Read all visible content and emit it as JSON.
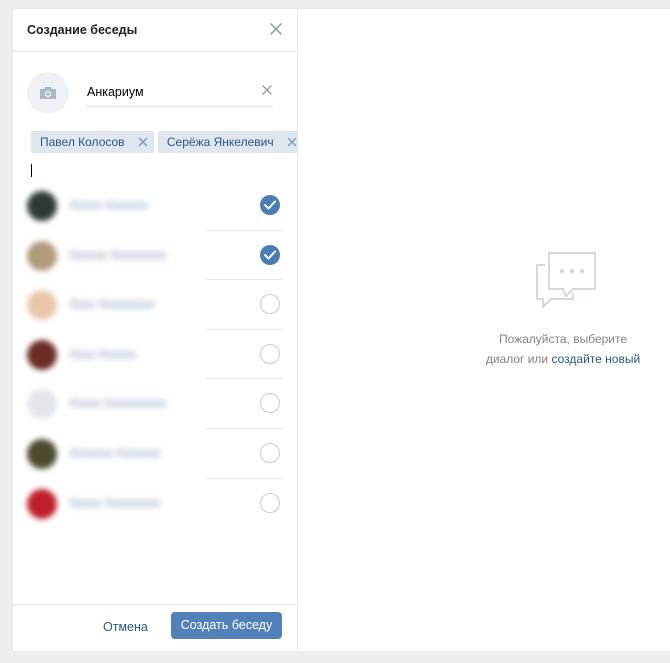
{
  "modal": {
    "title": "Создание беседы",
    "chat_name": "Анкариум",
    "close_icon": "close-icon",
    "camera_icon": "camera-icon"
  },
  "selected_tokens": [
    {
      "label": "Павел Колосов"
    },
    {
      "label": "Серёжа Янкелевич"
    }
  ],
  "friends": [
    {
      "name": "Xxxxx Xxxxxxx",
      "checked": true,
      "avatar_color": "#2f3a38"
    },
    {
      "name": "Xxxxxx Xxxxxxxxx",
      "checked": true,
      "avatar_color": "#b29a7c"
    },
    {
      "name": "Xxxx Xxxxxxxxx",
      "checked": false,
      "avatar_color": "#e8c7a8"
    },
    {
      "name": "Xxxx Xxxxxx",
      "checked": false,
      "avatar_color": "#6b2c26"
    },
    {
      "name": "Xxxxx Xxxxxxxxxx",
      "checked": false,
      "avatar_color": "#e2e5ea"
    },
    {
      "name": "Xxxxxxx Xxxxxxx",
      "checked": false,
      "avatar_color": "#4d4a2f"
    },
    {
      "name": "Xxxxx Xxxxxxxxx",
      "checked": false,
      "avatar_color": "#c01e2a"
    }
  ],
  "footer": {
    "cancel_label": "Отмена",
    "create_label": "Создать беседу"
  },
  "empty_state": {
    "icon": "chat-bubbles-icon",
    "line1": "Пожалуйста, выберите",
    "line2_prefix": "диалог или ",
    "line2_link": "создайте новый"
  },
  "colors": {
    "accent": "#5181b8",
    "link": "#2a5885",
    "token_bg": "#dfe6ee",
    "check_on": "#4a7eb3"
  }
}
